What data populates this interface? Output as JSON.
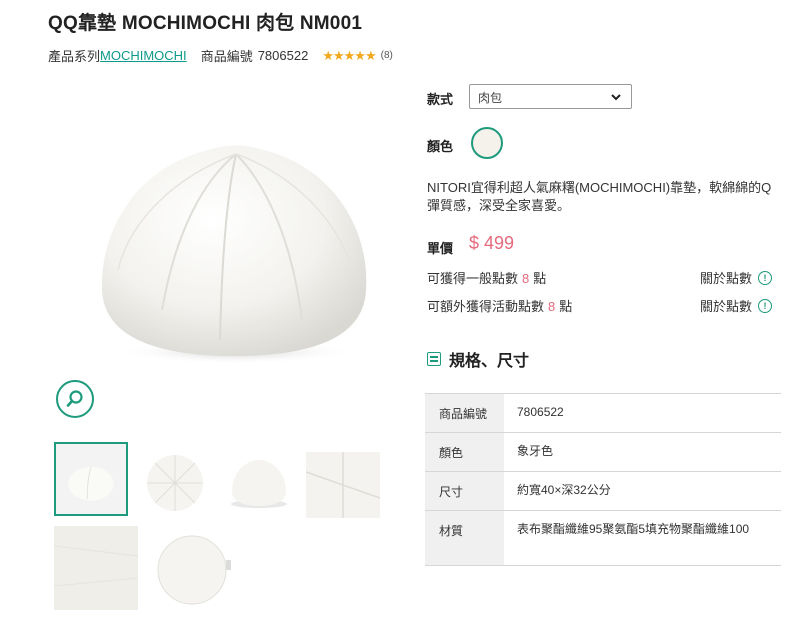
{
  "product": {
    "title": "QQ靠墊 MOCHIMOCHI 肉包 NM001",
    "series_label": "產品系列",
    "series_link": "MOCHIMOCHI",
    "code_label": "商品編號",
    "code_value": "7806522",
    "rating_stars": "★★★★★",
    "rating": 5,
    "review_count": "(8)"
  },
  "options": {
    "style_label": "款式",
    "style_value": "肉包",
    "color_label": "顏色",
    "swatch_color": "#f4f2ea"
  },
  "description": "NITORI宜得利超人氣麻糬(MOCHIMOCHI)靠墊，軟綿綿的Q彈質感，深受全家喜愛。",
  "price": {
    "label": "單價",
    "value": "$ 499"
  },
  "points": {
    "general_prefix": "可獲得一般點數",
    "general_value": "8",
    "general_suffix": "點",
    "event_prefix": "可額外獲得活動點數",
    "event_value": "8",
    "event_suffix": "點",
    "about_label": "關於點數"
  },
  "specs": {
    "heading": "規格、尺寸",
    "rows": [
      {
        "key": "商品編號",
        "value": "7806522"
      },
      {
        "key": "顏色",
        "value": "象牙色"
      },
      {
        "key": "尺寸",
        "value": "約寬40×深32公分"
      },
      {
        "key": "材質",
        "value": "表布聚酯纖維95聚氨酯5填充物聚酯纖維100"
      }
    ]
  },
  "colors": {
    "accent": "#1e9a7c",
    "price": "#e46a7d",
    "link": "#0d9a8a",
    "star": "#f2a71c"
  },
  "icons": [
    "zoom-icon",
    "chevron-down-icon",
    "info-icon",
    "spec-list-icon"
  ]
}
